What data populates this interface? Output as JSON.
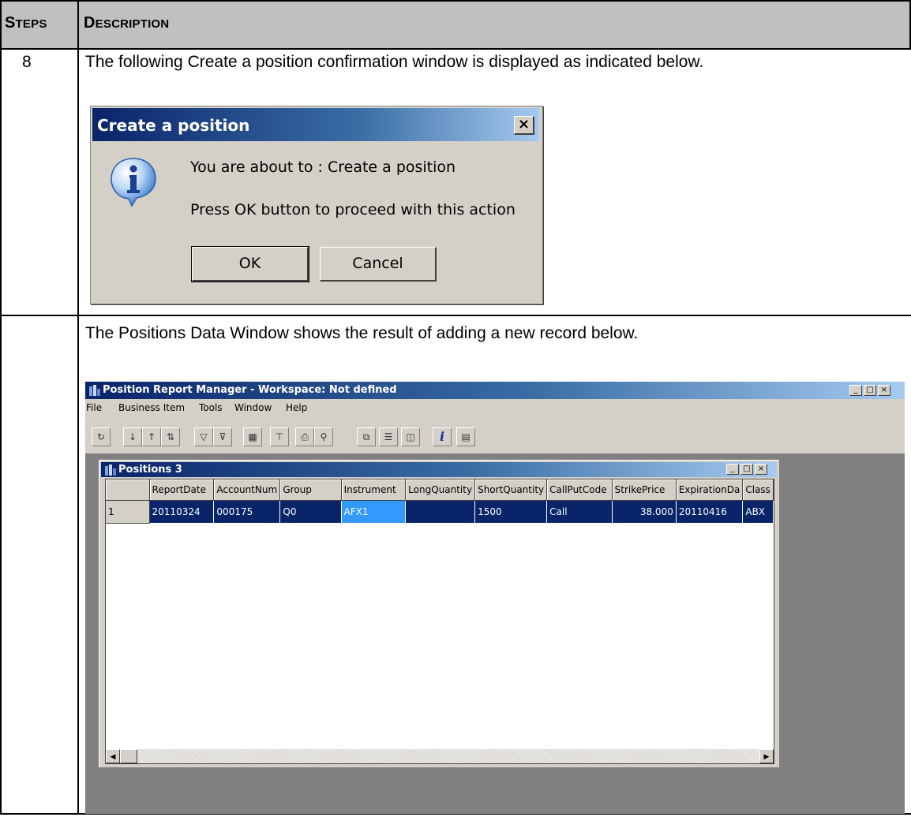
{
  "table_header": {
    "steps_first": "S",
    "steps_rest": "TEPS",
    "desc_first": "D",
    "desc_rest": "ESCRIPTION"
  },
  "row1": {
    "step": "8",
    "text": "The following Create a position confirmation window is displayed as indicated below."
  },
  "dialog": {
    "title": "Create a position",
    "close_label": "×",
    "line1": "You are about to : Create a position",
    "line2": "Press OK button to proceed with this action",
    "ok_label": "OK",
    "cancel_label": "Cancel"
  },
  "row2": {
    "step": "",
    "text": "The Positions Data Window shows the result of adding a new record below."
  },
  "app": {
    "title": "Position Report Manager - Workspace: Not defined",
    "window_buttons": [
      "_",
      "□",
      "×"
    ],
    "menu": [
      "File",
      "Business Item",
      "Tools",
      "Window",
      "Help"
    ],
    "toolbar_icons": [
      "refresh-icon",
      "sort-ascending-icon",
      "sort-descending-icon",
      "sort-custom-icon",
      "filter-icon",
      "filter-clear-icon",
      "chart-icon",
      "pin-icon",
      "print-icon",
      "find-icon",
      "window-cascade-icon",
      "window-tile-horizontal-icon",
      "window-tile-vertical-icon",
      "info-icon",
      "grid-icon"
    ],
    "child": {
      "title": "Positions 3",
      "columns": [
        "",
        "ReportDate",
        "AccountNum",
        "Group",
        "Instrument",
        "LongQuantity",
        "ShortQuantity",
        "CallPutCode",
        "StrikePrice",
        "ExpirationDa",
        "Class"
      ],
      "rows": [
        [
          "1",
          "20110324",
          "000175",
          "Q0",
          "AFX1",
          "",
          "1500",
          "Call",
          "38.000",
          "20110416",
          "ABX"
        ]
      ]
    }
  }
}
